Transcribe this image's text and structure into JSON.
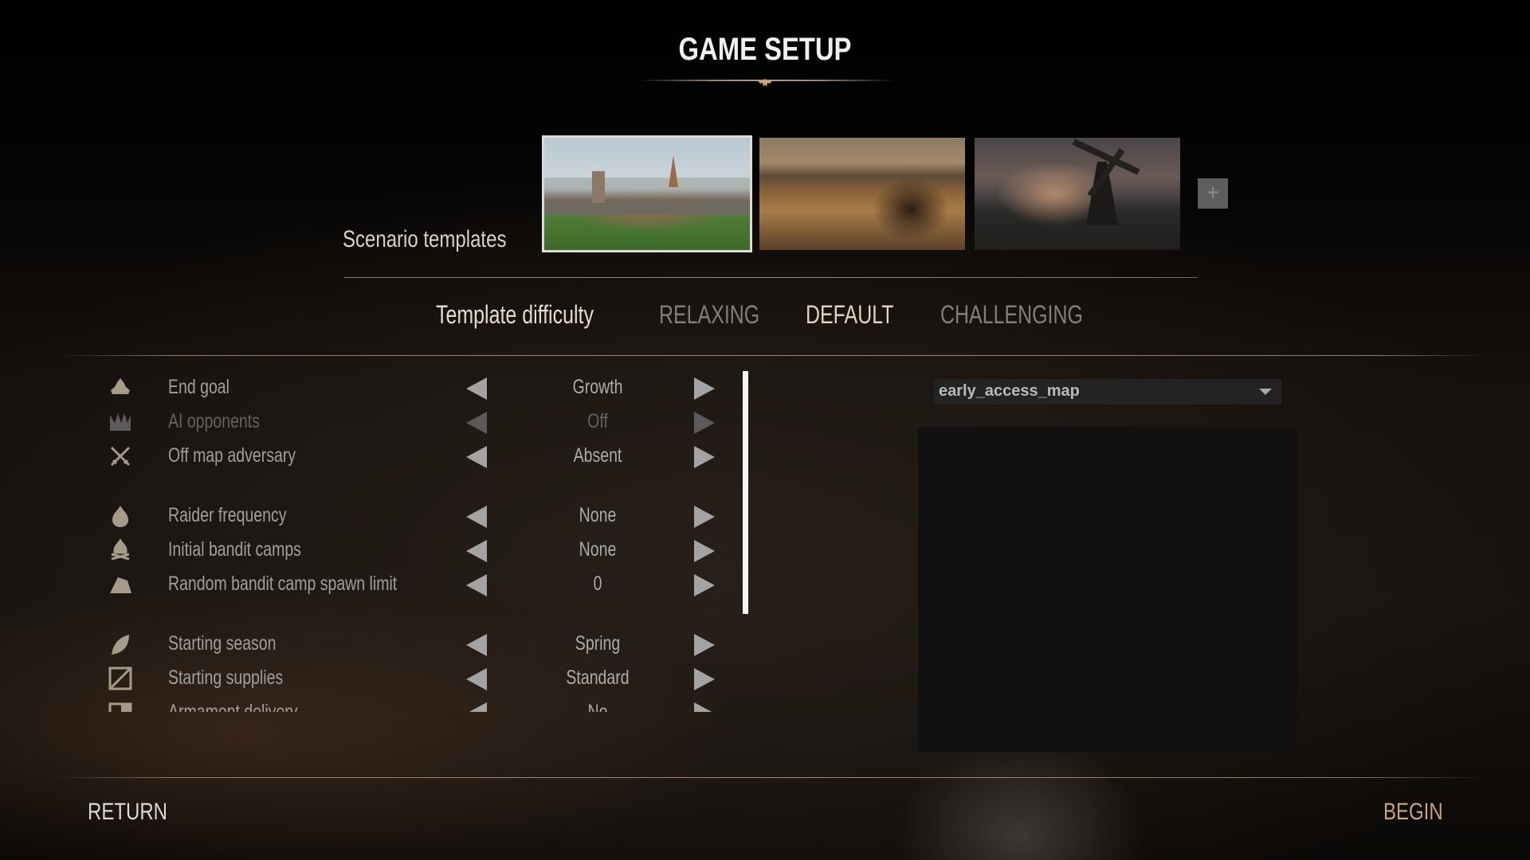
{
  "header": {
    "title": "GAME SETUP",
    "emblem_icon": "crest-emblem-icon"
  },
  "scenario": {
    "label": "Scenario templates",
    "templates": [
      {
        "name": "walled-town",
        "selected": true
      },
      {
        "name": "wheat-field",
        "selected": false
      },
      {
        "name": "windmill-ruin",
        "selected": false
      }
    ],
    "add_label": "+"
  },
  "difficulty": {
    "label": "Template difficulty",
    "options": [
      {
        "label": "RELAXING",
        "selected": false
      },
      {
        "label": "DEFAULT",
        "selected": true
      },
      {
        "label": "CHALLENGING",
        "selected": false
      }
    ]
  },
  "settings": [
    {
      "icon": "crown-bag-icon",
      "label": "End goal",
      "value": "Growth",
      "enabled": true
    },
    {
      "icon": "crown-icon",
      "label": "AI opponents",
      "value": "Off",
      "enabled": false
    },
    {
      "icon": "crossed-swords-icon",
      "label": "Off map adversary",
      "value": "Absent",
      "enabled": true
    },
    {
      "icon": "flame-icon",
      "label": "Raider frequency",
      "value": "None",
      "enabled": true
    },
    {
      "icon": "campfire-icon",
      "label": "Initial bandit camps",
      "value": "None",
      "enabled": true
    },
    {
      "icon": "tent-icon",
      "label": "Random bandit camp spawn limit",
      "value": "0",
      "enabled": true
    },
    {
      "icon": "leaf-icon",
      "label": "Starting season",
      "value": "Spring",
      "enabled": true
    },
    {
      "icon": "crate-icon",
      "label": "Starting supplies",
      "value": "Standard",
      "enabled": true
    },
    {
      "icon": "banner-icon",
      "label": "Armament delivery",
      "value": "No",
      "enabled": true
    }
  ],
  "map": {
    "selected": "early_access_map"
  },
  "footer": {
    "return_label": "RETURN",
    "begin_label": "BEGIN"
  },
  "colors": {
    "accent": "#c6a57a",
    "selected_text": "#e4d3bd",
    "muted_text": "#7f7f7f"
  }
}
